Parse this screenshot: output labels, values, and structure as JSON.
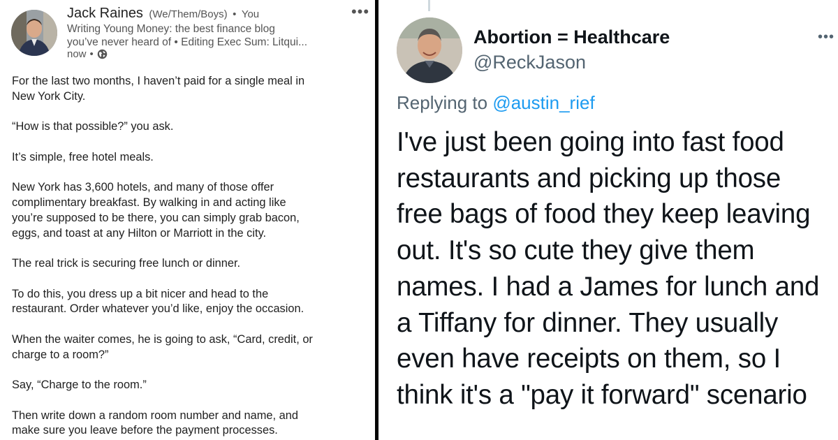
{
  "linkedin_post": {
    "author_name": "Jack Raines",
    "pronouns": "(We/Them/Boys)",
    "separator": "•",
    "relation": "You",
    "headline_lines": [
      "Writing Young Money: the best finance blog",
      "you’ve never heard of • Editing Exec Sum: Litqui..."
    ],
    "timestamp": "now",
    "meta_separator": "•",
    "visibility_icon": "globe-icon",
    "more_icon": "more-horizontal-icon",
    "more_label": "•••",
    "body_paragraphs": [
      [
        "For the last two months, I haven’t paid for a single meal in",
        "New York City."
      ],
      [
        "“How is that possible?” you ask."
      ],
      [
        "It’s simple, free hotel meals."
      ],
      [
        "New York has 3,600 hotels, and many of those offer",
        "complimentary breakfast. By walking in and acting like",
        "you’re supposed to be there, you can simply grab bacon,",
        "eggs, and toast at any Hilton or Marriott in the city."
      ],
      [
        "The real trick is securing free lunch or dinner."
      ],
      [
        "To do this, you dress up a bit nicer and head to the",
        "restaurant. Order whatever you’d like, enjoy the occasion."
      ],
      [
        "When the waiter comes, he is going to ask, “Card, credit, or",
        "charge to a room?”"
      ],
      [
        "Say, “Charge to the room.”"
      ],
      [
        "Then write down a random room number and name, and",
        "make sure you leave before the payment processes."
      ]
    ]
  },
  "tweet": {
    "display_name": "Abortion = Healthcare",
    "handle": "@ReckJason",
    "more_label": "•••",
    "replying_prefix": "Replying to",
    "replying_to": "@austin_rief",
    "text_lines": [
      "I've just been going into fast food",
      "restaurants and picking up those",
      "free bags of food they keep leaving",
      "out. It's so cute they give them",
      "names. I had a James for lunch and",
      "a Tiffany for dinner. They usually",
      "even have receipts on them, so I",
      "think it's a \"pay it forward\" scenario"
    ]
  },
  "colors": {
    "divider": "#050505",
    "linkedin_text": "#1f1f1f",
    "linkedin_secondary": "#555555",
    "twitter_text": "#0f1419",
    "twitter_secondary": "#536471",
    "twitter_link": "#1d9bf0"
  }
}
